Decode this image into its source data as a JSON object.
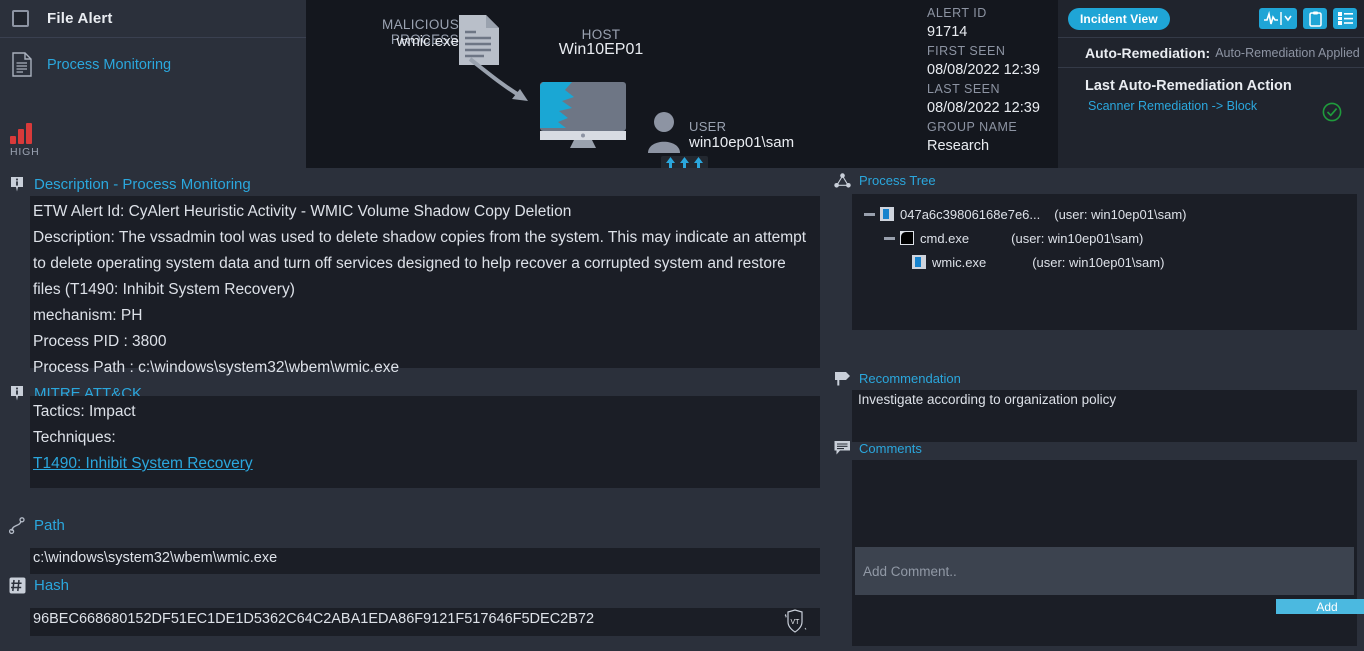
{
  "colors": {
    "accent": "#2ba7dd",
    "pill": "#1fa5d6",
    "severity_high": "#d93a3a",
    "ok_green": "#1f9b3c",
    "panel_bg": "#1b1e26",
    "chrome_bg": "#2b303b"
  },
  "alert_header": {
    "title": "File Alert",
    "subtitle": "Process Monitoring",
    "severity_label": "HIGH"
  },
  "graph": {
    "malicious_process_label": "MALICIOUS PROCESS",
    "malicious_process_value": "wmic.exe",
    "host_label": "HOST",
    "host_value": "Win10EP01",
    "user_label": "USER",
    "user_value": "win10ep01\\sam"
  },
  "metadata": [
    {
      "key": "ALERT ID",
      "value": "91714"
    },
    {
      "key": "FIRST SEEN",
      "value": "08/08/2022 12:39"
    },
    {
      "key": "LAST SEEN",
      "value": "08/08/2022 12:39"
    },
    {
      "key": "GROUP NAME",
      "value": "Research"
    }
  ],
  "incident_panel": {
    "view_pill": "Incident View",
    "auto_remediation_key": "Auto-Remediation:",
    "auto_remediation_value": "Auto-Remediation Applied",
    "last_action_title": "Last Auto-Remediation Action",
    "last_action_link": "Scanner Remediation -> Block"
  },
  "description": {
    "title": "Description - Process Monitoring",
    "lines": [
      "ETW Alert Id: CyAlert Heuristic Activity - WMIC Volume Shadow Copy Deletion",
      "Description: The vssadmin tool was used to delete shadow copies from the system. This may indicate an attempt to delete operating system data and turn off services designed to help recover a corrupted system and restore files (T1490: Inhibit System Recovery)",
      "mechanism: PH",
      "Process PID : 3800",
      "Process Path : c:\\windows\\system32\\wbem\\wmic.exe"
    ]
  },
  "mitre": {
    "title": "MITRE ATT&CK",
    "tactics": "Tactics: Impact",
    "techniques_label": "Techniques:",
    "technique_link": "T1490: Inhibit System Recovery"
  },
  "path": {
    "title": "Path",
    "value": "c:\\windows\\system32\\wbem\\wmic.exe"
  },
  "hash": {
    "title": "Hash",
    "value": "96BEC668680152DF51EC1DE1D5362C64C2ABA1EDA86F9121F517646F5DEC2B72",
    "vt_badge": "VT"
  },
  "process_tree": {
    "title": "Process Tree",
    "rows": [
      {
        "name": "047a6c39806168e7e6...",
        "user": "(user: win10ep01\\sam)",
        "depth": 0,
        "icon": "windows-exe-icon",
        "expander": true
      },
      {
        "name": "cmd.exe",
        "user": "(user: win10ep01\\sam)",
        "depth": 1,
        "icon": "cmd-console-icon",
        "expander": true
      },
      {
        "name": "wmic.exe",
        "user": "(user: win10ep01\\sam)",
        "depth": 2,
        "icon": "windows-exe-icon",
        "expander": false
      }
    ]
  },
  "recommendation": {
    "title": "Recommendation",
    "text": "Investigate according to organization policy"
  },
  "comments": {
    "title": "Comments",
    "input_placeholder": "Add Comment..",
    "input_value": "",
    "add_label": "Add"
  }
}
